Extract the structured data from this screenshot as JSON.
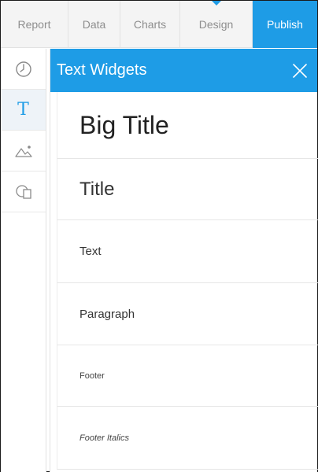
{
  "tabs": {
    "report": "Report",
    "data": "Data",
    "charts": "Charts",
    "design": "Design",
    "publish": "Publish"
  },
  "rail": {
    "items": [
      {
        "icon": "clock-icon"
      },
      {
        "icon": "text-icon",
        "glyph": "T",
        "active": true
      },
      {
        "icon": "image-icon"
      },
      {
        "icon": "shapes-icon"
      }
    ]
  },
  "panel": {
    "title": "Text Widgets",
    "widgets": [
      {
        "label": "Big Title"
      },
      {
        "label": "Title"
      },
      {
        "label": "Text"
      },
      {
        "label": "Paragraph"
      },
      {
        "label": "Footer"
      },
      {
        "label": "Footer Italics"
      }
    ]
  },
  "colors": {
    "accent": "#1e9ce6",
    "tabbar_bg": "#f4f4f4",
    "tab_text": "#8e8e8e"
  }
}
